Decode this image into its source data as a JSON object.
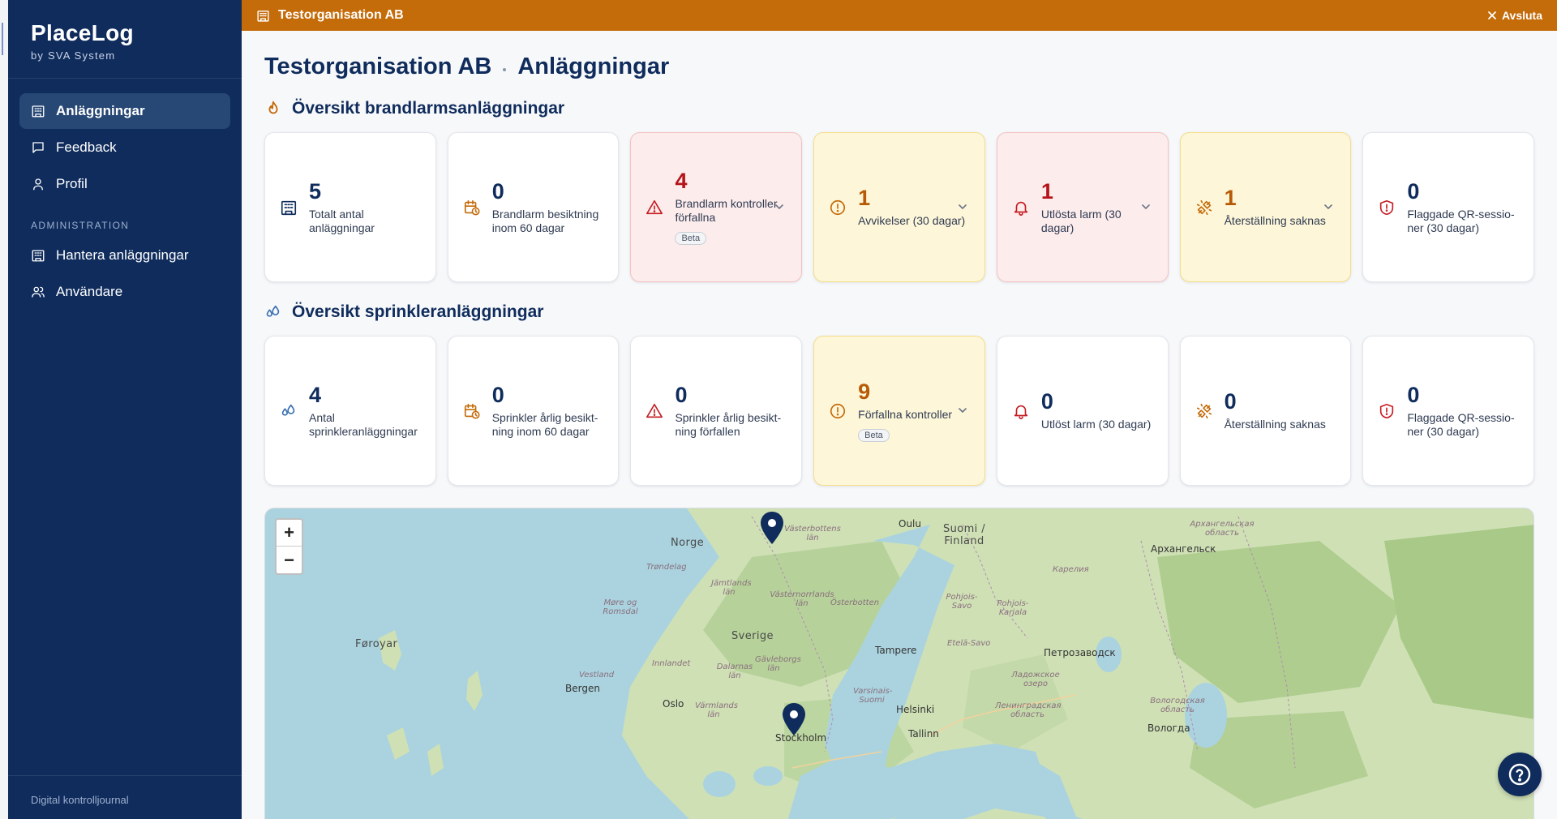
{
  "app": {
    "name": "PlaceLog",
    "subtitle": "by SVA System",
    "footer": "Digital kontrolljournal"
  },
  "sidebar": {
    "items": [
      {
        "label": "Anläggningar",
        "icon": "building-icon",
        "active": true
      },
      {
        "label": "Feedback",
        "icon": "message-icon"
      },
      {
        "label": "Profil",
        "icon": "user-icon"
      }
    ],
    "admin_header": "ADMINISTRATION",
    "admin_items": [
      {
        "label": "Hantera anläggningar",
        "icon": "building-icon"
      },
      {
        "label": "Användare",
        "icon": "users-icon"
      }
    ]
  },
  "topbar": {
    "org": "Testorganisation AB",
    "exit_label": "Avsluta",
    "color": "#c46b0a"
  },
  "page": {
    "org": "Testorganisation AB",
    "title": "Anläggningar"
  },
  "fire_section": {
    "title": "Översikt brandlarmsanläggningar",
    "cards": [
      {
        "value": "5",
        "label": "Totalt antal anläggningar",
        "icon": "building-icon",
        "tone": "neutral"
      },
      {
        "value": "0",
        "label": "Brandlarm besiktning inom 60 dagar",
        "icon": "calendar-clock-icon",
        "tone": "neutral"
      },
      {
        "value": "4",
        "label": "Brandlarm kon­troller förfallna",
        "icon": "warning-triangle-icon",
        "tone": "red",
        "badge": "Beta",
        "expandable": true
      },
      {
        "value": "1",
        "label": "Avvikelser (30 dagar)",
        "icon": "alert-circle-icon",
        "tone": "yellow",
        "expandable": true
      },
      {
        "value": "1",
        "label": "Utlösta larm (30 dagar)",
        "icon": "bell-icon",
        "tone": "red",
        "expandable": true
      },
      {
        "value": "1",
        "label": "Återställning saknas",
        "icon": "unplug-icon",
        "tone": "yellow",
        "expandable": true
      },
      {
        "value": "0",
        "label": "Flaggade QR-sessio­ner (30 dagar)",
        "icon": "shield-alert-icon",
        "tone": "neutral"
      }
    ]
  },
  "sprinkler_section": {
    "title": "Översikt sprinkleranläggningar",
    "cards": [
      {
        "value": "4",
        "label": "Antal sprinkleranläggning­ar",
        "icon": "droplets-icon",
        "tone": "neutral"
      },
      {
        "value": "0",
        "label": "Sprinkler årlig besikt­ning inom 60 dagar",
        "icon": "calendar-clock-icon",
        "tone": "neutral"
      },
      {
        "value": "0",
        "label": "Sprinkler årlig besikt­ning förfallen",
        "icon": "warning-triangle-icon",
        "tone": "neutral"
      },
      {
        "value": "9",
        "label": "Förfallna kontroller",
        "icon": "alert-circle-icon",
        "tone": "yellow",
        "badge": "Beta",
        "expandable": true
      },
      {
        "value": "0",
        "label": "Utlöst larm (30 dagar)",
        "icon": "bell-icon",
        "tone": "neutral"
      },
      {
        "value": "0",
        "label": "Återställning saknas",
        "icon": "unplug-icon",
        "tone": "neutral"
      },
      {
        "value": "0",
        "label": "Flaggade QR-sessio­ner (30 dagar)",
        "icon": "shield-alert-icon",
        "tone": "neutral"
      }
    ]
  },
  "map": {
    "zoom_in": "+",
    "zoom_out": "−",
    "labels": {
      "oulu": "Oulu",
      "finland": "Suomi / Finland",
      "arkh_obl": "Архангельская область",
      "arkh": "Архангельск",
      "norge": "Norge",
      "vasterbotten": "Västerbottens län",
      "trondelag": "Trøndelag",
      "karelia": "Карелия",
      "jamtland": "Jämtlands län",
      "vasternorrland": "Västernorrlands län",
      "osterbotten": "Österbotten",
      "pohjois_savo": "Pohjois-Savo",
      "pohjois_karjala": "Pohjois-Karjala",
      "more": "Møre og Romsdal",
      "sverige": "Sverige",
      "faroe": "Føroyar",
      "tampere": "Tampere",
      "etela_savo": "Etelä-Savo",
      "petroz": "Петрозаводск",
      "gavleborg": "Gävleborgs län",
      "innlandet": "Innlandet",
      "dalarna": "Dalarnas län",
      "vestland": "Vestland",
      "ladoga": "Ладожское озеро",
      "bergen": "Bergen",
      "varsinais": "Varsinais-Suomi",
      "oslo": "Oslo",
      "varmland": "Värmlands län",
      "helsinki": "Helsinki",
      "lenobl": "Ленинградская область",
      "vologda_obl": "Вологодская область",
      "tallinn": "Tallinn",
      "vologda": "Вологда",
      "stockholm": "Stockholm"
    }
  },
  "help": {
    "icon": "help-circle-icon"
  }
}
